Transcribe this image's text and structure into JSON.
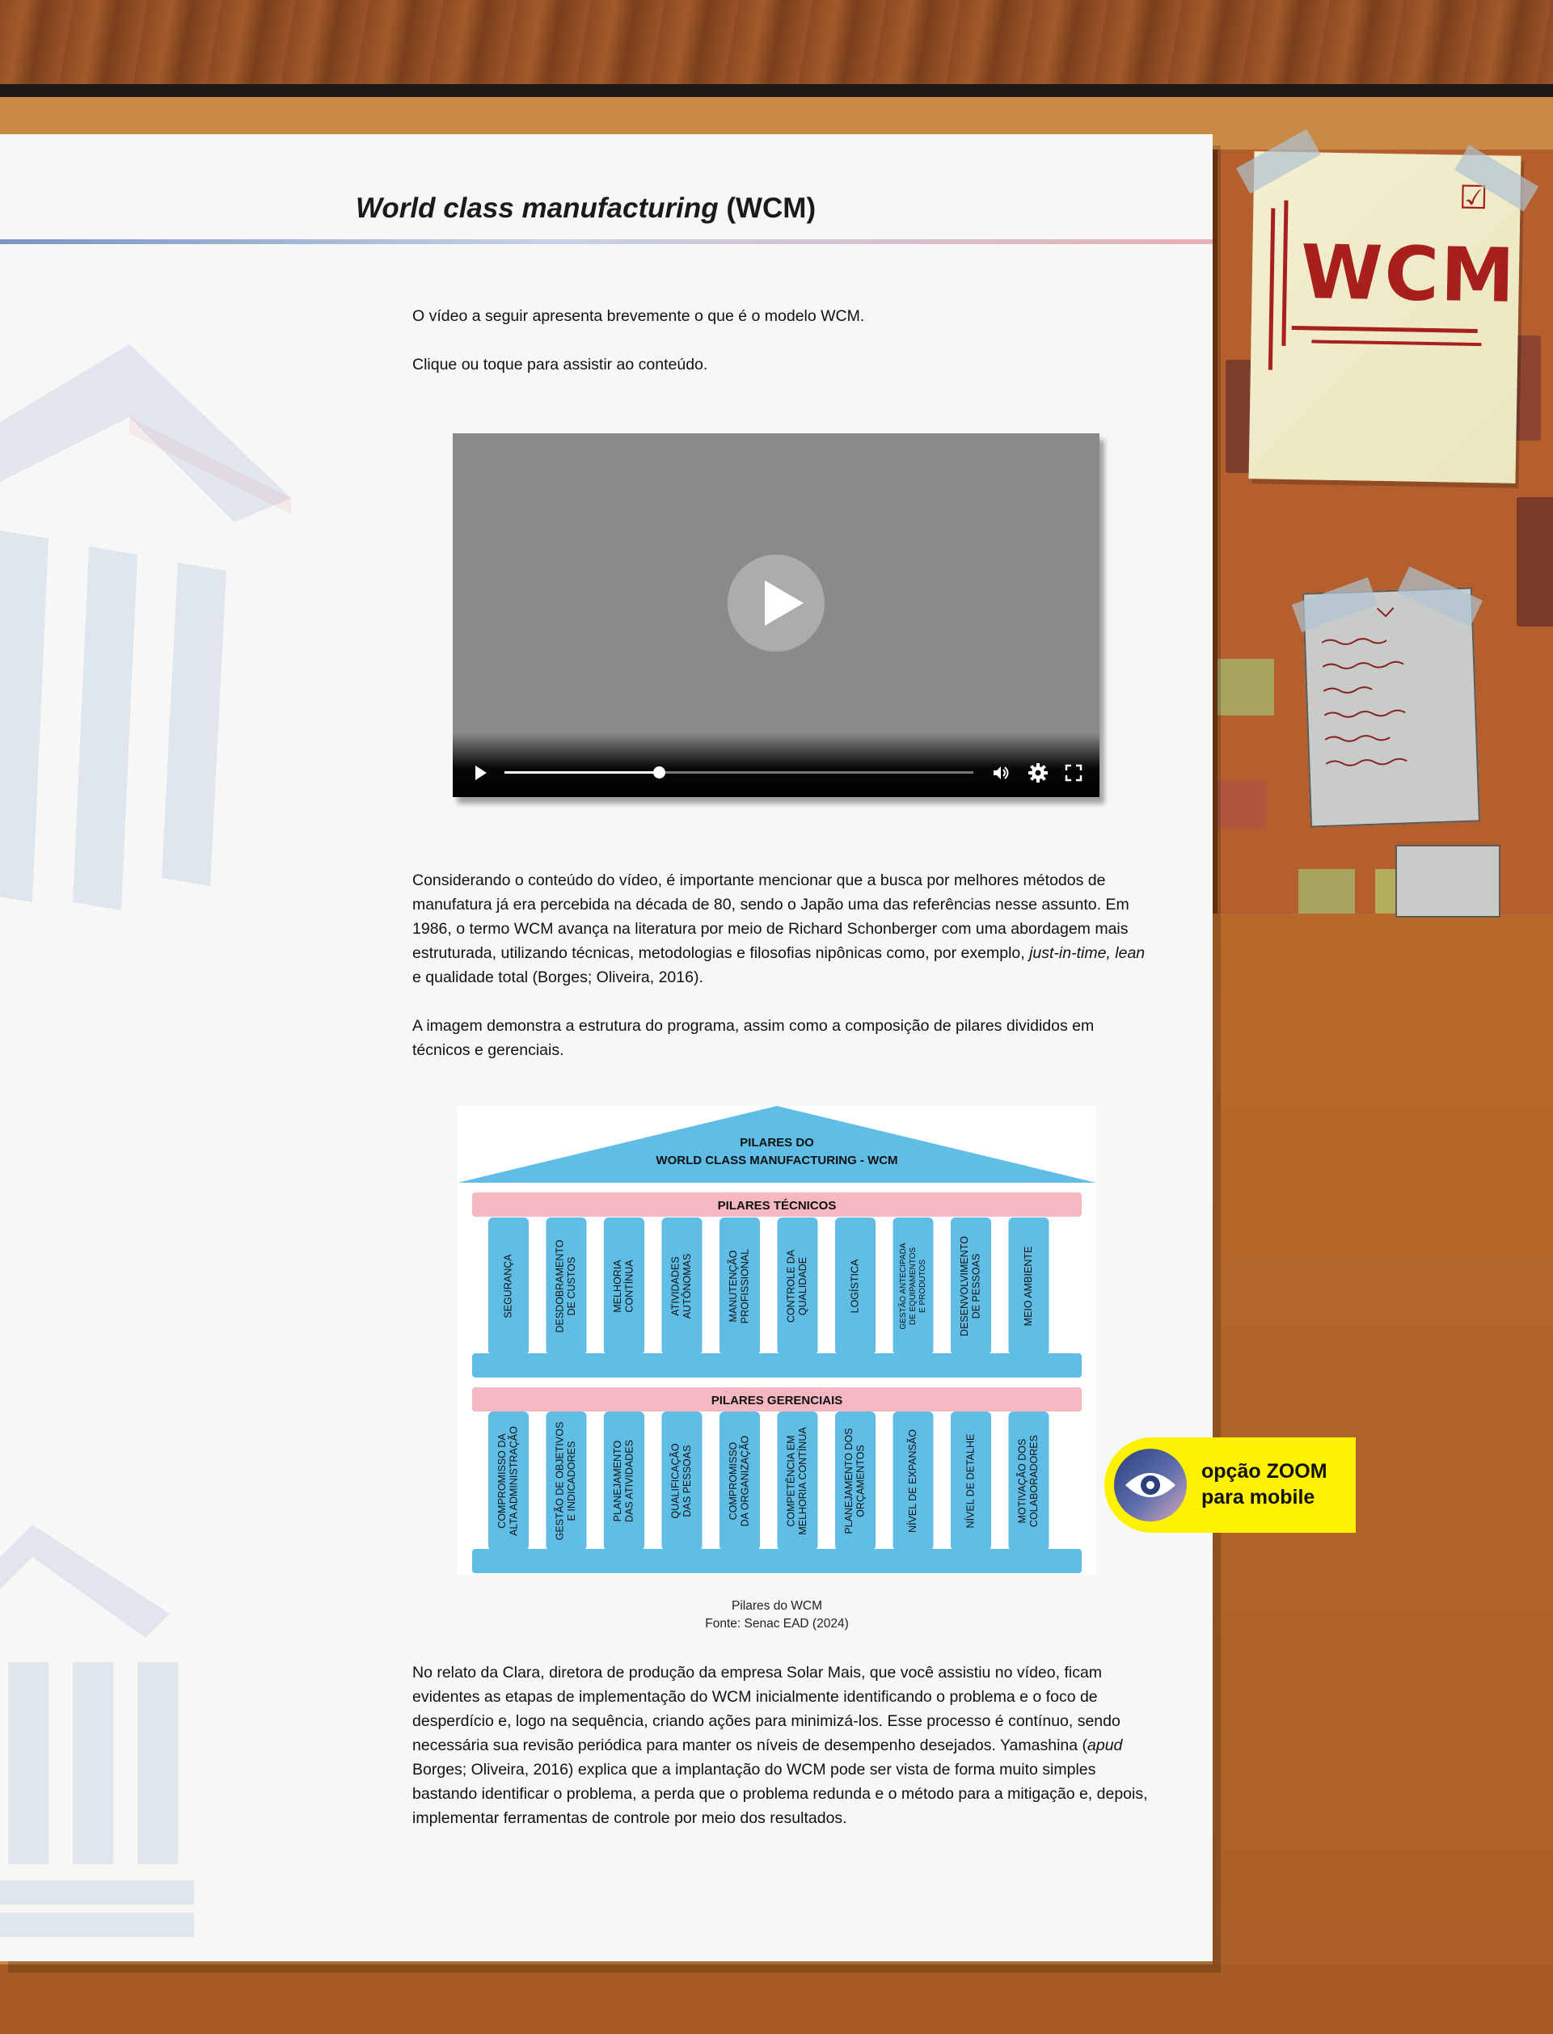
{
  "page": {
    "title_italic": "World class manufacturing",
    "title_rest": " (WCM)"
  },
  "intro": {
    "line1": "O vídeo a seguir apresenta brevemente o que é o modelo WCM.",
    "line2": "Clique ou toque para assistir ao conteúdo."
  },
  "video": {
    "progress": 0.33
  },
  "body": {
    "p1_a": "Considerando o conteúdo do vídeo, é importante mencionar que a busca por melhores métodos de manufatura já era percebida na década de 80, sendo o Japão uma das referências nesse assunto. Em 1986, o termo WCM avança na literatura por meio de Richard Schonberger com uma abordagem mais estruturada, utilizando técnicas, metodologias e filosofias nipônicas como, por exemplo, ",
    "p1_em": "just-in-time, lean",
    "p1_b": " e qualidade total (Borges; Oliveira, 2016).",
    "p2": "A imagem demonstra a estrutura do programa, assim como a composição de pilares divididos em técnicos e gerenciais.",
    "p3_a": "No relato da Clara, diretora de produção da empresa Solar Mais, que você assistiu no vídeo, ficam evidentes as etapas de implementação do WCM inicialmente identificando o problema e o foco de desperdício e, logo na sequência, criando ações para minimizá-los. Esse processo é contínuo, sendo necessária sua revisão periódica para manter os níveis de desempenho desejados. Yamashina (",
    "p3_em": "apud",
    "p3_b": " Borges; Oliveira, 2016) explica que a implantação do WCM pode ser vista de forma muito simples bastando identificar o problema, a perda que o problema redunda e o método para a mitigação e, depois, implementar ferramentas de controle por meio dos resultados."
  },
  "diagram": {
    "roof_line1": "PILARES DO",
    "roof_line2": "WORLD CLASS MANUFACTURING - WCM",
    "tecnicos_label": "PILARES TÉCNICOS",
    "gerenciais_label": "PILARES GERENCIAIS",
    "tecnicos": [
      [
        "SEGURANÇA"
      ],
      [
        "DESDOBRAMENTO",
        "DE CUSTOS"
      ],
      [
        "MELHORIA",
        "CONTÍNUA"
      ],
      [
        "ATIVIDADES",
        "AUTÔNOMAS"
      ],
      [
        "MANUTENÇÃO",
        "PROFISSIONAL"
      ],
      [
        "CONTROLE DA",
        "QUALIDADE"
      ],
      [
        "LOGÍSTICA"
      ],
      [
        "GESTÃO ANTECIPADA",
        "DE EQUIPAMENTOS",
        "E PRODUTOS"
      ],
      [
        "DESENVOLVIMENTO",
        "DE PESSOAS"
      ],
      [
        "MEIO AMBIENTE"
      ]
    ],
    "gerenciais": [
      [
        "COMPROMISSO DA",
        "ALTA ADMINISTRAÇÃO"
      ],
      [
        "GESTÃO DE OBJETIVOS",
        "E INDICADORES"
      ],
      [
        "PLANEJAMENTO",
        "DAS ATIVIDADES"
      ],
      [
        "QUALIFICAÇÃO",
        "DAS PESSOAS"
      ],
      [
        "COMPROMISSO",
        "DA ORGANIZAÇÃO"
      ],
      [
        "COMPETÊNCIA EM",
        "MELHORIA CONTÍNUA"
      ],
      [
        "PLANEJAMENTO DOS",
        "ORÇAMENTOS"
      ],
      [
        "NÍVEL DE EXPANSÃO"
      ],
      [
        "NÍVEL DE DETALHE"
      ],
      [
        "MOTIVAÇÃO DOS",
        "COLABORADORES"
      ]
    ],
    "caption_line1": "Pilares do WCM",
    "caption_line2": "Fonte: Senac EAD (2024)"
  },
  "zoom": {
    "line1": "opção ZOOM",
    "line2": "para mobile"
  },
  "board": {
    "note_title": "WCM"
  },
  "colors": {
    "pillar_blue": "#5fbde6",
    "band_pink": "#f6b8c0",
    "zoom_yellow": "#fff200"
  }
}
